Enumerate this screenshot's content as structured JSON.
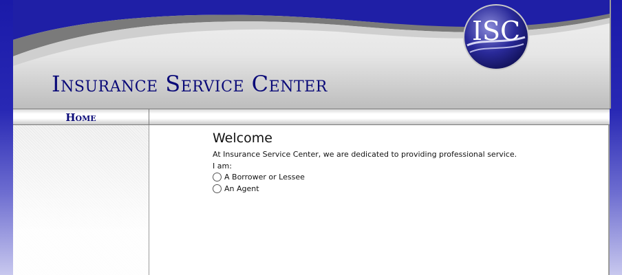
{
  "header": {
    "site_title": "Insurance Service Center",
    "logo_text": "ISC"
  },
  "nav": {
    "home_label": "Home"
  },
  "main": {
    "heading": "Welcome",
    "intro": "At Insurance Service Center, we are dedicated to providing professional service.",
    "prompt": "I am:",
    "options": [
      {
        "label": "A Borrower or Lessee",
        "selected": false
      },
      {
        "label": "An Agent",
        "selected": false
      }
    ]
  },
  "colors": {
    "brand_blue": "#0a0a78",
    "background_blue": "#1a1aa8"
  }
}
